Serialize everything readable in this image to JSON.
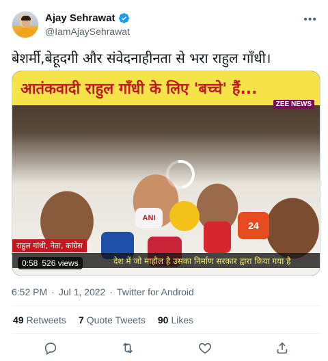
{
  "author": {
    "display_name": "Ajay Sehrawat",
    "handle": "@IamAjaySehrawat",
    "verified": true
  },
  "tweet": {
    "text": "बेशर्मी,बेहूदगी और संवेदनाहीनता से भरा राहुल गाँधी।",
    "timestamp": "6:52 PM",
    "date": "Jul 1, 2022",
    "source": "Twitter for Android"
  },
  "media": {
    "banner_text": "आतंकवादी राहुल गाँधी के लिए 'बच्चे' हैं...",
    "channel_logo": "ZEE NEWS",
    "caption_tag": "राहुल गांधी, नेता, कांग्रेस",
    "caption_text": "देश में जो माहौल है उसका निर्माण सरकार द्वारा किया गया है",
    "duration": "0:58",
    "views": "526 views",
    "mic_label": "ANI",
    "mic_label_2": "24"
  },
  "stats": {
    "retweets_count": "49",
    "retweets_label": "Retweets",
    "quote_count": "7",
    "quote_label": "Quote Tweets",
    "likes_count": "90",
    "likes_label": "Likes"
  },
  "colors": {
    "verified": "#1d9bf0",
    "banner_bg": "#f6e34a",
    "banner_text": "#c0191f",
    "secondary_text": "#536471"
  },
  "icons": [
    "verified-badge-icon",
    "more-icon",
    "reply-icon",
    "retweet-icon",
    "like-icon",
    "share-icon",
    "loading-spinner-icon"
  ]
}
